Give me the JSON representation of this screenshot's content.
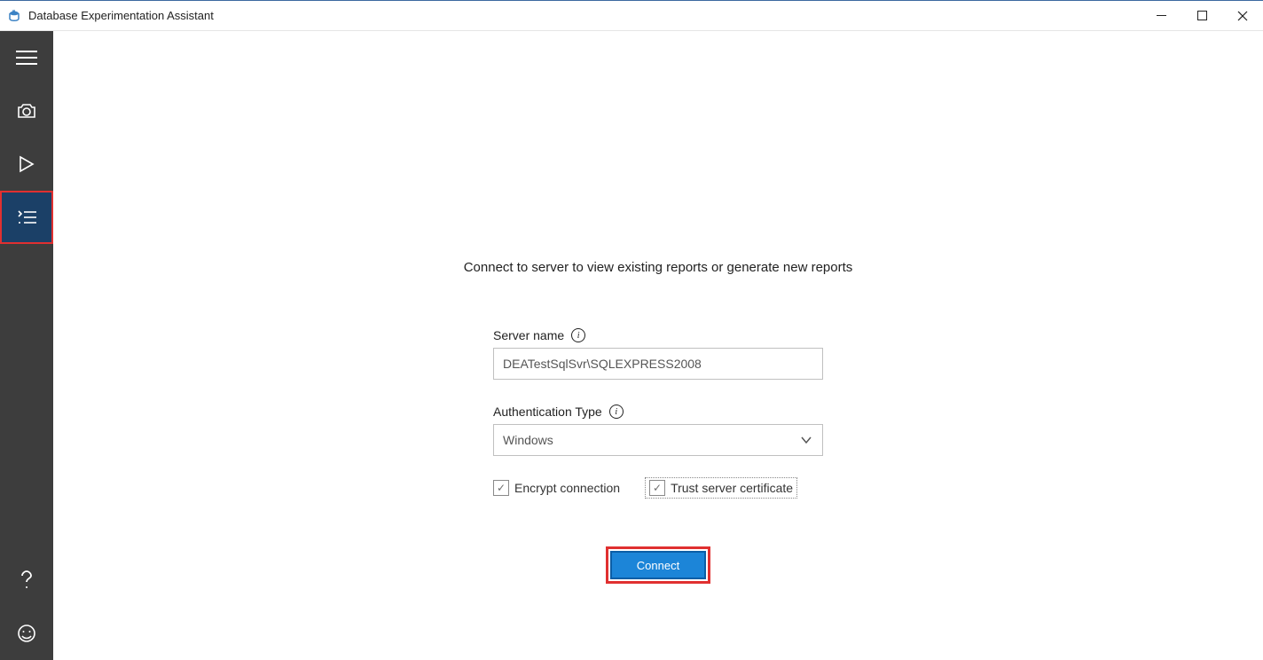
{
  "window": {
    "title": "Database Experimentation Assistant"
  },
  "sidebar": {
    "items": [
      {
        "name": "menu",
        "active": false
      },
      {
        "name": "camera",
        "active": false
      },
      {
        "name": "play",
        "active": false
      },
      {
        "name": "reports",
        "active": true
      }
    ],
    "footer": [
      {
        "name": "help"
      },
      {
        "name": "feedback"
      }
    ]
  },
  "main": {
    "heading": "Connect to server to view existing reports or generate new reports",
    "server_name_label": "Server name",
    "server_name_value": "DEATestSqlSvr\\SQLEXPRESS2008",
    "auth_type_label": "Authentication Type",
    "auth_type_value": "Windows",
    "encrypt_label": "Encrypt connection",
    "encrypt_checked": true,
    "trust_label": "Trust server certificate",
    "trust_checked": true,
    "connect_label": "Connect"
  }
}
